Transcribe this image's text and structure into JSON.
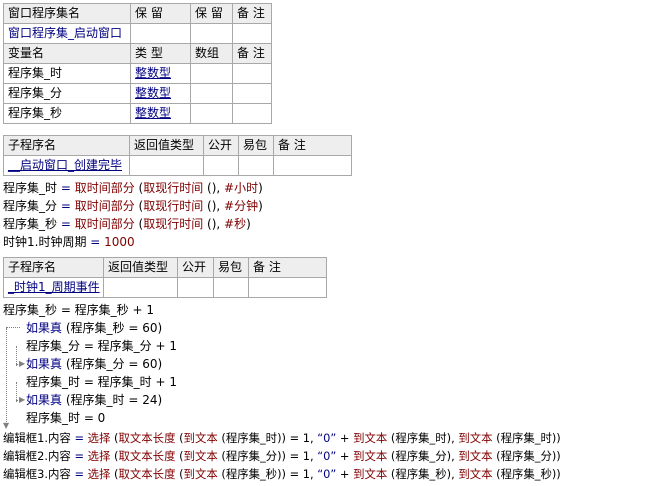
{
  "window_table": {
    "headers": [
      "窗口程序集名",
      "保 留",
      "保 留",
      "备 注"
    ],
    "name": "窗口程序集_启动窗口"
  },
  "var_table": {
    "headers": [
      "变量名",
      "类 型",
      "数组",
      "备 注"
    ],
    "rows": [
      {
        "name": "程序集_时",
        "type": "整数型"
      },
      {
        "name": "程序集_分",
        "type": "整数型"
      },
      {
        "name": "程序集_秒",
        "type": "整数型"
      }
    ]
  },
  "sub1": {
    "headers": [
      "子程序名",
      "返回值类型",
      "公开",
      "易包",
      "备 注"
    ],
    "name": "__启动窗口_创建完毕"
  },
  "sub1_lines": [
    {
      "var": "程序集_时",
      "eq": " = ",
      "fn": "取时间部分",
      "open": " (",
      "fn2": "取现行时间",
      "args": " (), ",
      "const": "#小时",
      "close": ")"
    },
    {
      "var": "程序集_分",
      "eq": " = ",
      "fn": "取时间部分",
      "open": " (",
      "fn2": "取现行时间",
      "args": " (), ",
      "const": "#分钟",
      "close": ")"
    },
    {
      "var": "程序集_秒",
      "eq": " = ",
      "fn": "取时间部分",
      "open": " (",
      "fn2": "取现行时间",
      "args": " (), ",
      "const": "#秒",
      "close": ")"
    }
  ],
  "timer_line": {
    "lhs": "时钟1.时钟周期",
    "eq": " = ",
    "val": "1000"
  },
  "sub2": {
    "headers": [
      "子程序名",
      "返回值类型",
      "公开",
      "易包",
      "备 注"
    ],
    "name": "_时钟1_周期事件"
  },
  "sub2_code": {
    "l1": "程序集_秒 = 程序集_秒 + 1",
    "if_kw": "如果真",
    "if1": " (程序集_秒 = 60)",
    "l2": "程序集_分 = 程序集_分 + 1",
    "if2": " (程序集_分 = 60)",
    "l3": "程序集_时 = 程序集_时 + 1",
    "if3": " (程序集_时 = 24)",
    "l4": "程序集_时 = 0"
  },
  "edit_lines": [
    {
      "lhs": "编辑框1.内容",
      "var": "程序集_时"
    },
    {
      "lhs": "编辑框2.内容",
      "var": "程序集_分"
    },
    {
      "lhs": "编辑框3.内容",
      "var": "程序集_秒"
    }
  ],
  "edit_tokens": {
    "eq": " = ",
    "sel": "选择",
    "p1": " (",
    "len": "取文本长度",
    "p2": " (",
    "totext": "到文本",
    "p3": " (",
    "mid": ")) = 1, ",
    "zero": "“0”",
    "plus": " + ",
    "p4": " (",
    "p5": "), ",
    "p6": " (",
    "end": "))"
  }
}
